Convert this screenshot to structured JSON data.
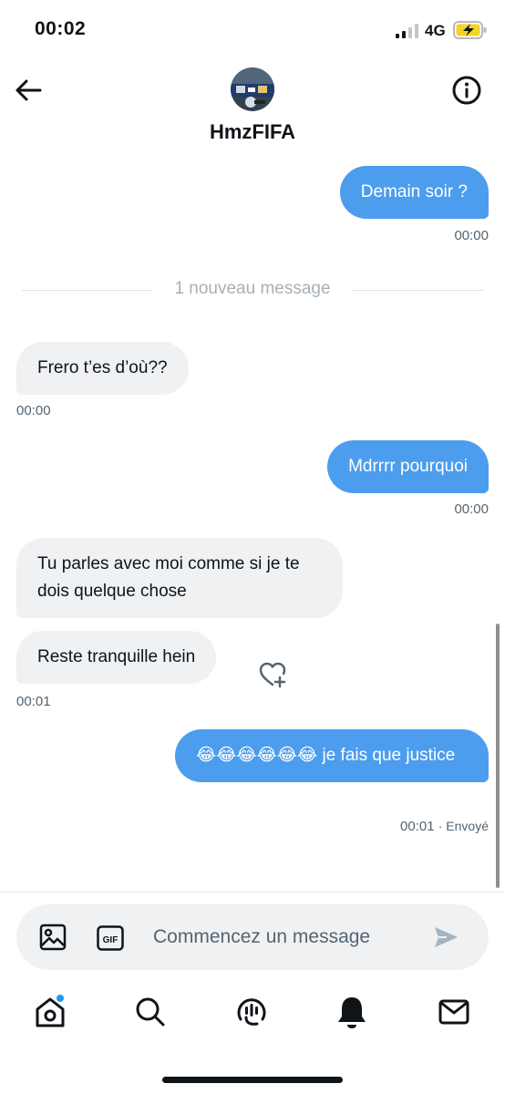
{
  "status_bar": {
    "time": "00:02",
    "network": "4G"
  },
  "header": {
    "contact_name": "HmzFIFA"
  },
  "divider": {
    "text": "1 nouveau message"
  },
  "messages": [
    {
      "text": "Demain soir ?",
      "time": "00:00"
    },
    {
      "text": "Frero t’es d’où??",
      "time": "00:00"
    },
    {
      "text": "Mdrrrr pourquoi",
      "time": "00:00"
    },
    {
      "text": "Tu parles avec moi comme si je te dois quelque chose"
    },
    {
      "text": "Reste tranquille hein",
      "time": "00:01"
    },
    {
      "text": "😂😂😂😂😂😂 je fais que justice",
      "time": "00:01",
      "status": "· Envoyé"
    }
  ],
  "composer": {
    "placeholder": "Commencez un message",
    "gif_label": "GIF"
  },
  "icons": {
    "back": "arrow-left-icon",
    "info": "info-icon",
    "media": "image-icon",
    "gif": "gif-icon",
    "send": "send-icon",
    "heart": "heart-plus-icon",
    "nav": [
      "home-icon",
      "search-icon",
      "spaces-icon",
      "bell-icon",
      "mail-icon"
    ]
  },
  "colors": {
    "outgoing_bubble": "#4c9ded",
    "incoming_bubble": "#eff1f3",
    "accent": "#1d9bf0"
  }
}
